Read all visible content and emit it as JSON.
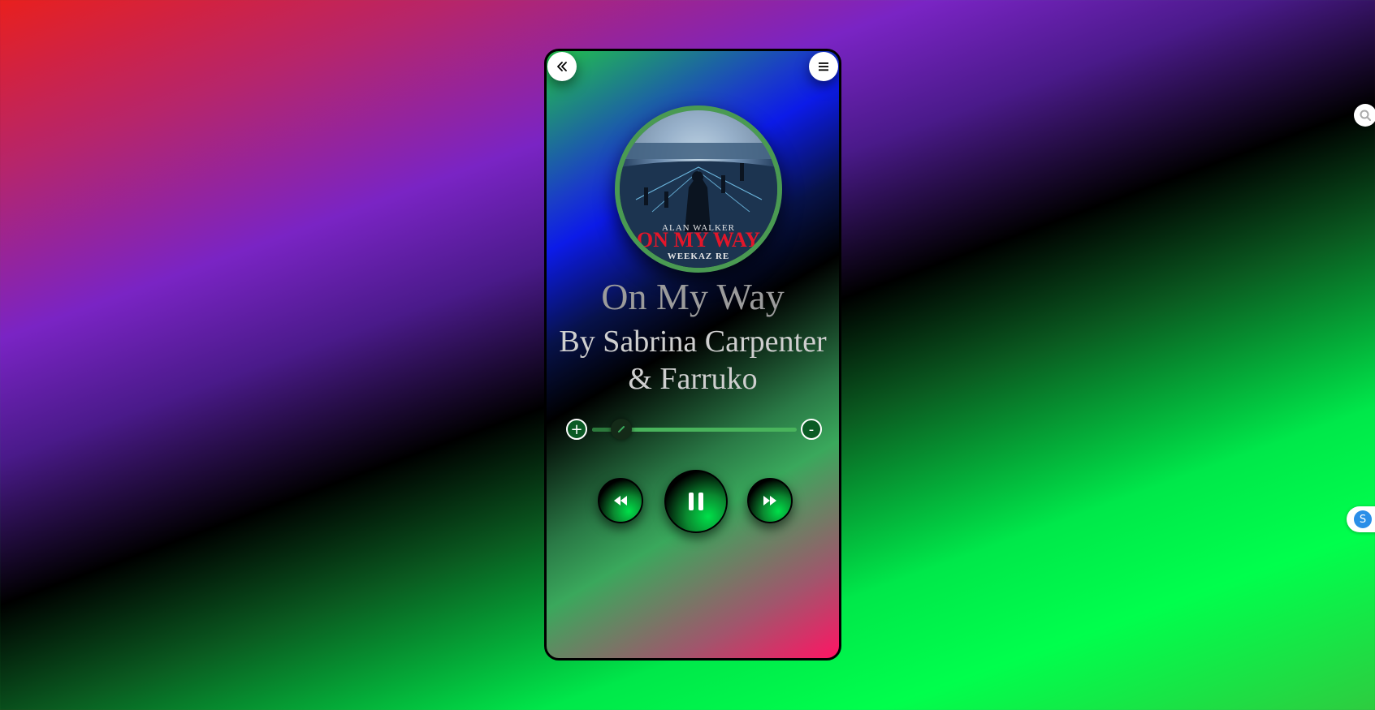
{
  "player": {
    "back_icon": "double-chevron-left-icon",
    "menu_icon": "hamburger-menu-icon",
    "album_art": {
      "text_artist": "ALAN WALKER",
      "text_title": "ON MY WAY",
      "text_remix": "WEEKAZ RE"
    },
    "song_title": "On My Way",
    "artist": "By Sabrina Carpenter & Farruko",
    "volume": {
      "plus_label": "+",
      "minus_label": "-",
      "level": 0.1
    },
    "controls": {
      "prev_icon": "rewind-icon",
      "play_icon": "pause-icon",
      "next_icon": "fast-forward-icon"
    },
    "colors": {
      "accent": "#4a9a52",
      "track": "#49b45c"
    }
  },
  "edge_widgets": {
    "search_icon": "search-icon",
    "skype_label": "S"
  }
}
